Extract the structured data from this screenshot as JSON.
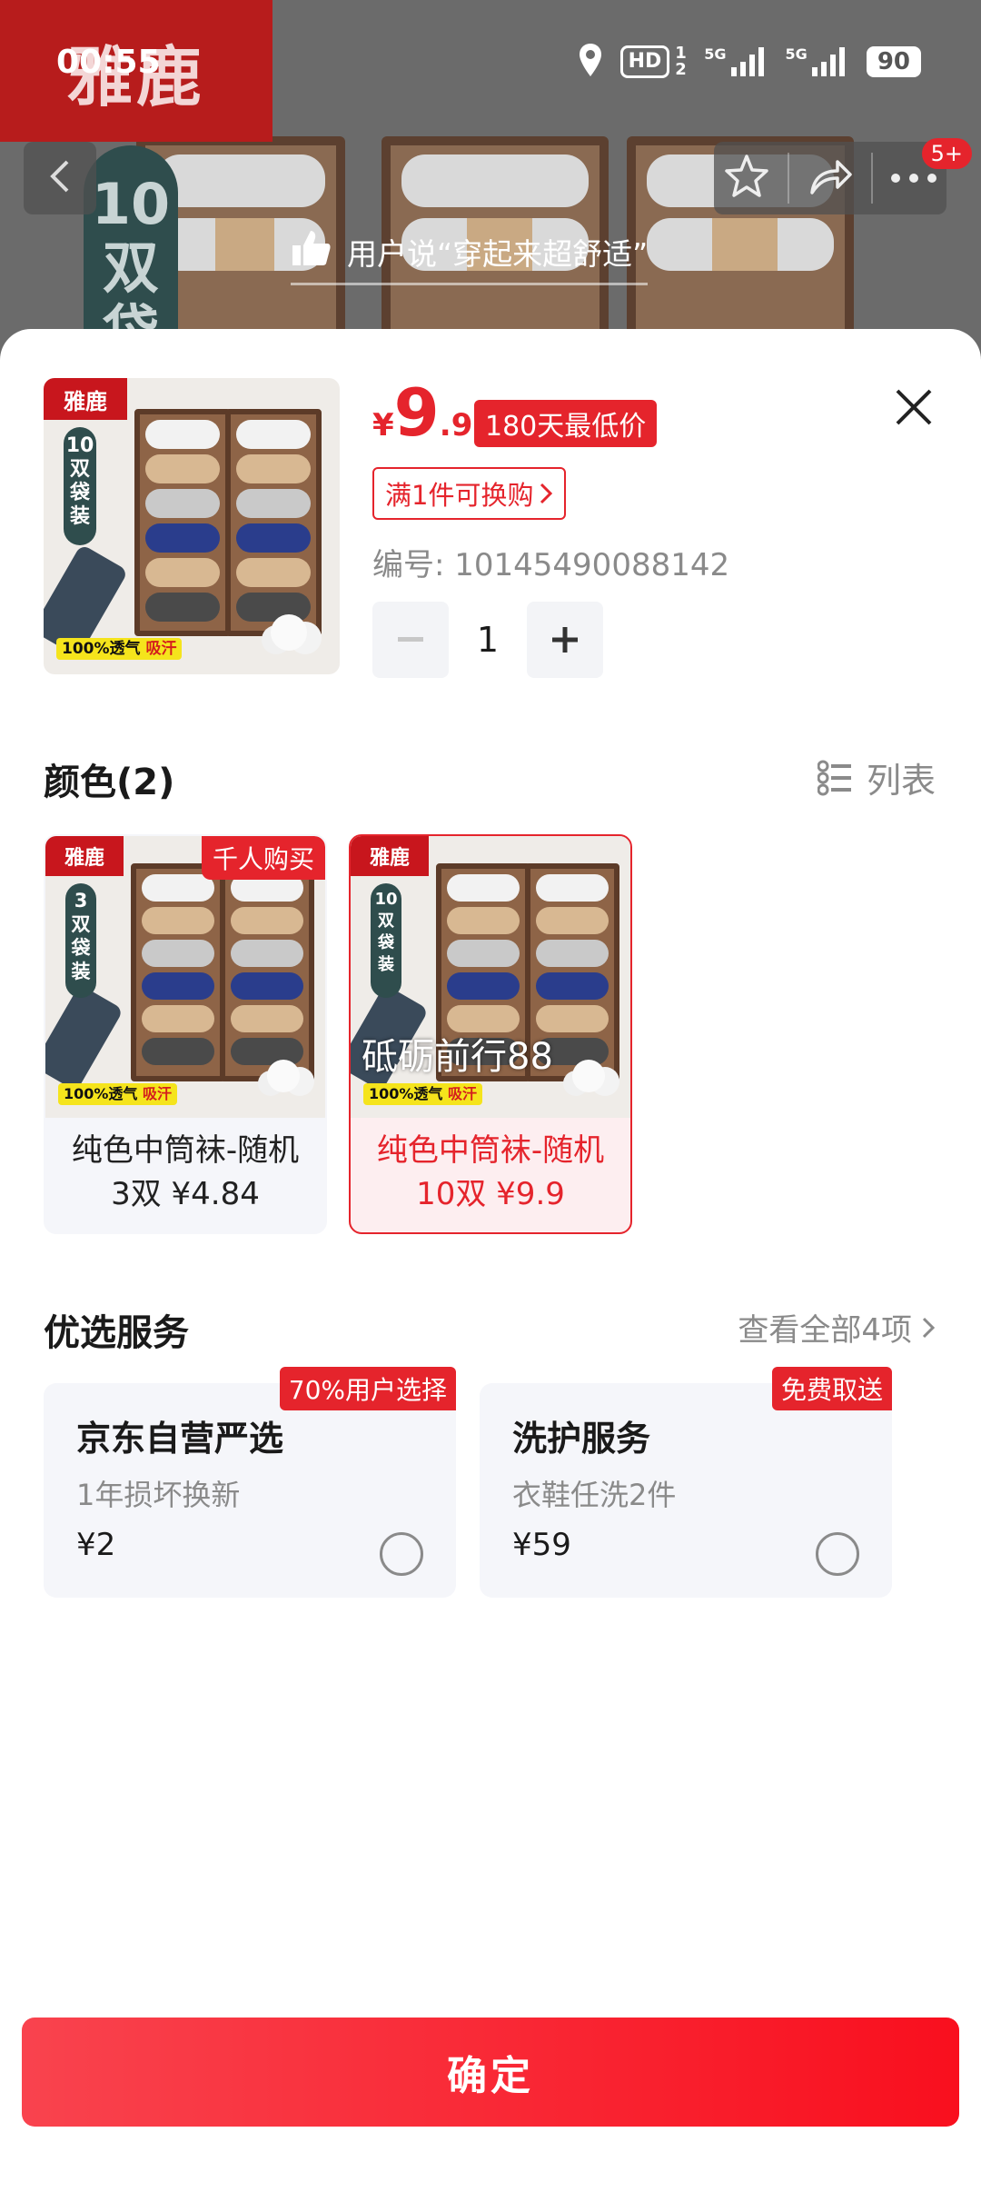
{
  "status": {
    "time": "00:55",
    "hd": "HD",
    "hd_sub": "1 2",
    "net1": "5G",
    "net2": "5G",
    "battery": "90"
  },
  "background": {
    "brand_logo": "雅鹿",
    "tag_text": "10双袋",
    "notif_count": "5+",
    "comment": "用户说“穿起来超舒适”"
  },
  "product": {
    "thumb_logo": "雅鹿",
    "thumb_tag": "10双袋装",
    "thumb_foot_a": "100%透气",
    "thumb_foot_b": "吸汗",
    "price_symbol": "¥",
    "price_int": "9",
    "price_dec": ".9",
    "low_badge": "180天最低价",
    "promo": "满1件可换购",
    "sku": "编号: 10145490088142",
    "qty": "1"
  },
  "colors": {
    "title": "颜色(2)",
    "list_toggle": "列表",
    "options": [
      {
        "name_line1": "纯色中筒袜-随机",
        "name_line2": "3双 ¥4.84",
        "badge": "千人购买",
        "tag": "3双袋装",
        "logo": "雅鹿",
        "foot_a": "100%透气",
        "foot_b": "吸汗"
      },
      {
        "name_line1": "纯色中筒袜-随机",
        "name_line2": "10双 ¥9.9",
        "overlay": "砥砺前行88",
        "tag": "10双袋装",
        "logo": "雅鹿",
        "foot_a": "100%透气",
        "foot_b": "吸汗"
      }
    ]
  },
  "services": {
    "title": "优选服务",
    "view_all": "查看全部4项",
    "items": [
      {
        "badge": "70%用户选择",
        "title": "京东自营严选",
        "sub": "1年损坏换新",
        "price": "¥2"
      },
      {
        "badge": "免费取送",
        "title": "洗护服务",
        "sub": "衣鞋任洗2件",
        "price": "¥59"
      }
    ]
  },
  "confirm_label": "确定",
  "colors_theme": {
    "accent": "#e5242c",
    "muted": "#8a8a8a",
    "card_bg": "#f5f6fa"
  }
}
